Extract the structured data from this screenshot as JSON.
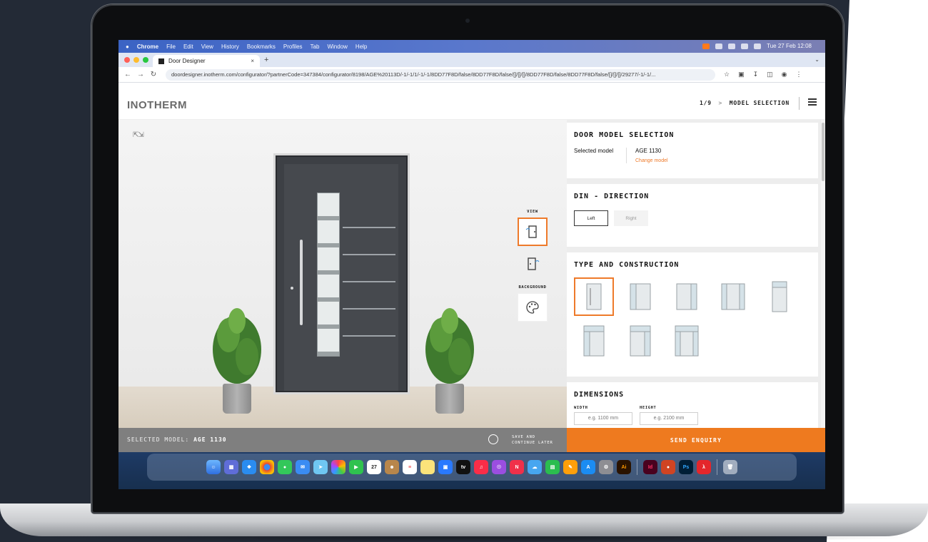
{
  "menubar": {
    "items": [
      "Chrome",
      "File",
      "Edit",
      "View",
      "History",
      "Bookmarks",
      "Profiles",
      "Tab",
      "Window",
      "Help"
    ],
    "clock": "Tue 27 Feb 12:08"
  },
  "browser": {
    "tab_title": "Door Designer",
    "tab_close": "×",
    "new_tab": "+",
    "url": "doordesigner.inotherm.com/configurator/?partnerCode=347384/configurator/8198/AGE%20113D/-1/-1/1/-1/-1/8DD77F8D/false/8DD77F8D/false/[]/[]/[]/8DD77F8D/false/8DD77F8D/false/[]/[]/[]/29277/-1/-1/..."
  },
  "app": {
    "brand": "INOTHERM",
    "step": "1/9",
    "step_separator": ">",
    "step_title": "MODEL SELECTION"
  },
  "preview": {
    "view_label": "VIEW",
    "background_label": "BACKGROUND",
    "footer_selected_prefix": "SELECTED MODEL:",
    "footer_selected_model": "AGE 1130",
    "save_line1": "SAVE AND",
    "save_line2": "CONTINUE LATER"
  },
  "panel": {
    "model_section": {
      "title": "DOOR MODEL SELECTION",
      "selected_label": "Selected model",
      "selected_value": "AGE 1130",
      "change_link": "Change model"
    },
    "direction_section": {
      "title": "DIN - DIRECTION",
      "options": [
        "Left",
        "Right"
      ],
      "selected": "Left"
    },
    "type_section": {
      "title": "TYPE AND CONSTRUCTION",
      "selected_index": 0
    },
    "dimensions_section": {
      "title": "DIMENSIONS",
      "width_label": "WIDTH",
      "width_placeholder": "e.g. 1100 mm",
      "height_label": "HEIGHT",
      "height_placeholder": "e.g. 2100 mm"
    }
  },
  "send_button": "SEND ENQUIRY",
  "dock": {
    "calendar_day": "27",
    "tv_label": "tv",
    "ai_label": "Ai",
    "id_label": "Id",
    "ps_label": "Ps"
  },
  "colors": {
    "accent": "#ee7a1f",
    "door": "#46494e",
    "footer": "#7f7f7f"
  }
}
